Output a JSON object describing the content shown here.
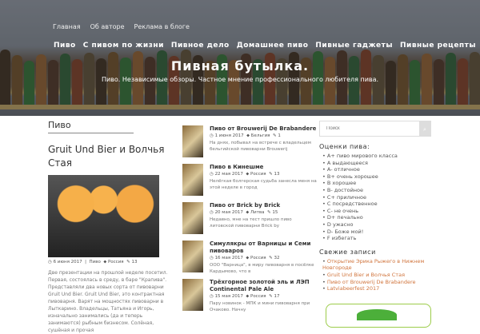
{
  "header": {
    "top_nav": [
      "Главная",
      "Об авторе",
      "Реклама в блоге"
    ],
    "main_nav": [
      "Пиво",
      "С пивом по жизни",
      "Пивное дело",
      "Домашнее пиво",
      "Пивные гаджеты",
      "Пивные рецепты"
    ],
    "site_title": "Пивная бутылка.",
    "tagline": "Пиво. Независимые обзоры. Частное мнение профессионального любителя пива."
  },
  "left": {
    "section_title": "Пиво",
    "post": {
      "title": "Gruit Und Bier и Волчья Стая",
      "date": "6 июня 2017",
      "category": "Пиво",
      "tag": "Россия",
      "comments": "13",
      "excerpt": "Две презентации на прошлой неделе посетил. Первая, состоялась в среду, в баре \"Крапива\". Представляли два новых сорта от пивоварни Gruit Und Bier. Gruit Und Bier, это контрактная пивоварня. Варят на мощностях пивоварни в Лыткарино. Владельцы, Татьяна и Игорь, изначально занимались (да и теперь занимаются) рыбным бизнесом. Солёная, сушёная и прочая"
    }
  },
  "mid": {
    "items": [
      {
        "title": "Пиво от Brouwerij De Brabandere",
        "date": "1 июня 2017",
        "tag": "Бельгия",
        "comments": "1",
        "excerpt": "На днях, побывал на встрече с владельцем бельгийской пивоварни Brouwerij"
      },
      {
        "title": "Пиво в Кинешме",
        "date": "22 мая 2017",
        "tag": "Россия",
        "comments": "13",
        "excerpt": "Нелёгкая болгерская судьба занесла меня на этой неделе в город"
      },
      {
        "title": "Пиво от Brick by Brick",
        "date": "20 мая 2017",
        "tag": "Литва",
        "comments": "15",
        "excerpt": "Недавно, мне на тест пришло пиво литовской пивоварни Brick by"
      },
      {
        "title": "Симулякры от Варницы и Семи пивоваров",
        "date": "16 мая 2017",
        "tag": "Россия",
        "comments": "32",
        "excerpt": "ООО \"Варница\", в миру пивоварня в посёлке Кардымово, что в"
      },
      {
        "title": "Трёхгорное золотой эль и ЛЭП Continental Pale Ale",
        "date": "15 мая 2017",
        "tag": "Россия",
        "comments": "17",
        "excerpt": "Пару новинок - МПК и мини пивоварня при Очаково. Начну"
      }
    ]
  },
  "right": {
    "search_placeholder": "Поиск",
    "ratings_title": "Оценки пива:",
    "ratings": [
      "A+ пиво мирового класса",
      "A выдающееся",
      "A- отличное",
      "B+ очень хорошее",
      "B хорошее",
      "B- достойное",
      "C+ приличное",
      "C посредственное",
      "C- не очень",
      "D+ печально",
      "D ужасно",
      "D- Боже мой!",
      "F избегать"
    ],
    "recent_title": "Свежие записи",
    "recent": [
      "Открытие Эрика Рыжего в Нижнем Новгороде",
      "Gruit Und Bier и Волчья Стая",
      "Пиво от Brouwerij De Brabandere",
      "Latviabeerfest 2017"
    ]
  }
}
